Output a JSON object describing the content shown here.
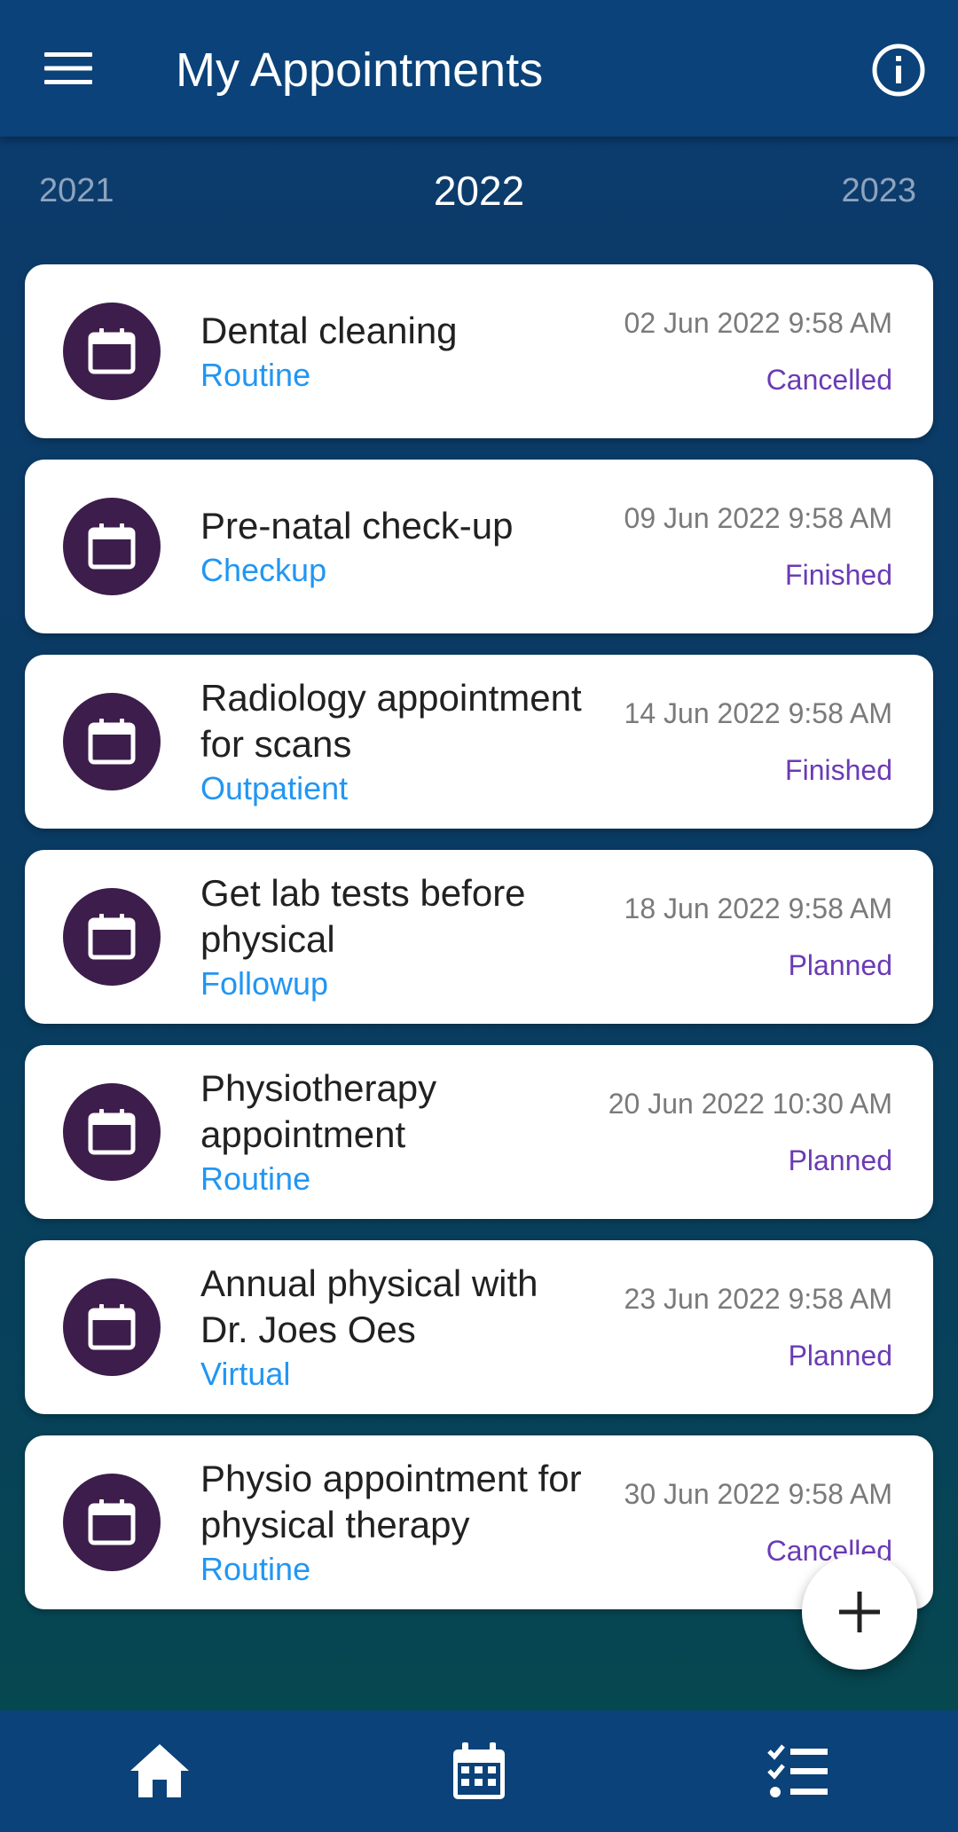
{
  "app": {
    "title": "My Appointments"
  },
  "header": {
    "menu_icon": "hamburger-menu-icon",
    "info_icon": "info-circle-icon"
  },
  "years": {
    "previous": "2021",
    "current": "2022",
    "next": "2023"
  },
  "appointments": [
    {
      "title": "Dental cleaning",
      "type": "Routine",
      "datetime": "02 Jun 2022 9:58 AM",
      "status": "Cancelled"
    },
    {
      "title": "Pre-natal check-up",
      "type": "Checkup",
      "datetime": "09 Jun 2022 9:58 AM",
      "status": "Finished"
    },
    {
      "title": "Radiology appointment for scans",
      "type": "Outpatient",
      "datetime": "14 Jun 2022 9:58 AM",
      "status": "Finished"
    },
    {
      "title": "Get lab tests before physical",
      "type": "Followup",
      "datetime": "18 Jun 2022 9:58 AM",
      "status": "Planned"
    },
    {
      "title": "Physiotherapy appointment",
      "type": "Routine",
      "datetime": "20 Jun 2022 10:30 AM",
      "status": "Planned"
    },
    {
      "title": "Annual physical with Dr. Joes Oes",
      "type": "Virtual",
      "datetime": "23 Jun 2022 9:58 AM",
      "status": "Planned"
    },
    {
      "title": "Physio appointment for physical therapy",
      "type": "Routine",
      "datetime": "30 Jun 2022 9:58 AM",
      "status": "Cancelled"
    }
  ],
  "fab": {
    "icon": "plus-icon"
  },
  "bottom_nav": {
    "items": [
      "home-icon",
      "calendar-icon",
      "checklist-icon"
    ]
  },
  "colors": {
    "appbar": "#0a4279",
    "icon_circle": "#3c1d4b",
    "type_text": "#2196f3",
    "status_text": "#6a3bb5",
    "date_text": "#7a7a7a"
  }
}
